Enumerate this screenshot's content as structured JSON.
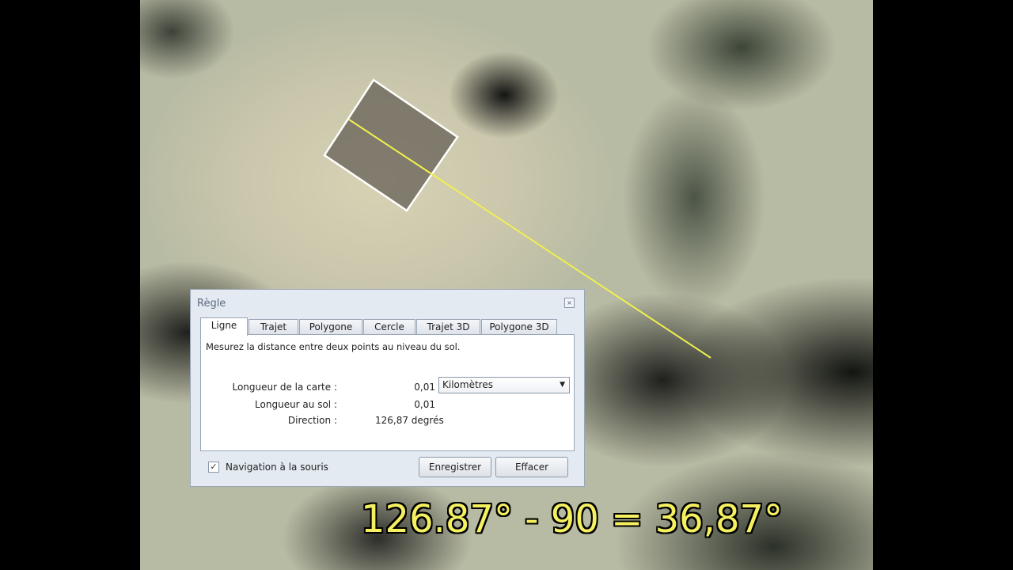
{
  "dialog": {
    "title": "Règle",
    "close_glyph": "×",
    "tabs": [
      {
        "label": "Ligne"
      },
      {
        "label": "Trajet"
      },
      {
        "label": "Polygone"
      },
      {
        "label": "Cercle"
      },
      {
        "label": "Trajet 3D"
      },
      {
        "label": "Polygone 3D"
      }
    ],
    "description": "Mesurez la distance entre deux points au niveau du sol.",
    "map_length_label": "Longueur de la carte :",
    "map_length_value": "0,01",
    "unit_selected": "Kilomètres",
    "ground_length_label": "Longueur au sol :",
    "ground_length_value": "0,01",
    "direction_label": "Direction :",
    "direction_value": "126,87 degrés",
    "mouse_nav_label": "Navigation à la souris",
    "mouse_nav_checked": true,
    "save_button": "Enregistrer",
    "clear_button": "Effacer"
  },
  "caption": "126.87° - 90 = 36,87°",
  "colors": {
    "measure_line": "#f0f050",
    "caption_text": "#f5f060"
  },
  "icons": {
    "close": "close-icon",
    "checkbox": "checkmark-icon",
    "dropdown": "chevron-down-icon"
  }
}
